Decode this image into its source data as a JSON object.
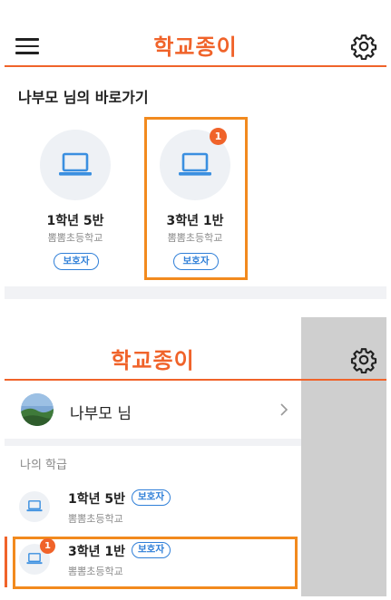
{
  "brand": "학교종이",
  "home": {
    "greeting": "나부모 님의 바로가기",
    "cards": [
      {
        "class_name": "1학년 5반",
        "school": "뽐뽐초등학교",
        "role": "보호자",
        "badge": ""
      },
      {
        "class_name": "3학년 1반",
        "school": "뽐뽐초등학교",
        "role": "보호자",
        "badge": "1"
      }
    ]
  },
  "drawer": {
    "user_name": "나부모 님",
    "section_title": "나의 학급",
    "items": [
      {
        "class_name": "1학년 5반",
        "school": "뽐뽐초등학교",
        "role": "보호자",
        "badge": ""
      },
      {
        "class_name": "3학년 1반",
        "school": "뽐뽐초등학교",
        "role": "보호자",
        "badge": "1"
      }
    ]
  },
  "colors": {
    "brand": "#f0632a",
    "role_chip": "#2f7fd8",
    "highlight": "#f28a1e",
    "overlay": "#cfcfcf"
  },
  "icons": [
    "hamburger-menu-icon",
    "gear-icon",
    "laptop-icon",
    "chevron-right-icon"
  ]
}
